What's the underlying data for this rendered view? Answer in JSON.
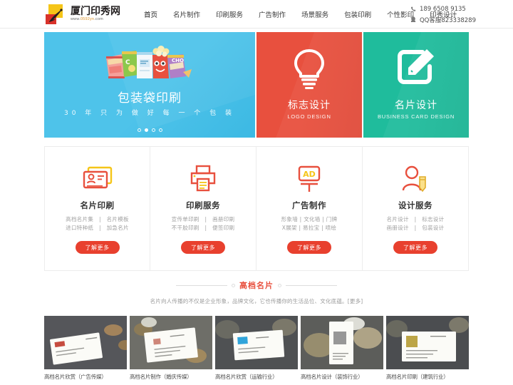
{
  "header": {
    "logo": {
      "cn": "厦门印秀网",
      "url_pre": "www.",
      "url_hl": "0592yn",
      "url_post": ".com"
    },
    "nav": [
      {
        "label": "首页",
        "active": true
      },
      {
        "label": "名片制作",
        "active": false
      },
      {
        "label": "印刷服务",
        "active": false
      },
      {
        "label": "广告制作",
        "active": false
      },
      {
        "label": "场景服务",
        "active": false
      },
      {
        "label": "包装印刷",
        "active": false
      },
      {
        "label": "个性影印",
        "active": false
      },
      {
        "label": "印秀设计",
        "active": false
      }
    ],
    "contact": {
      "phone_icon": "phone-icon",
      "phone": "189 6508 9135",
      "qq_icon": "qq-penguin-icon",
      "qq": "QQ客服823338289"
    }
  },
  "hero": {
    "main": {
      "title": "包装袋印刷",
      "subtitle": "30 年 只 为 做 好 每 一 个 包 装",
      "icon": "snack-bags-illustration",
      "bg_color": "#4ec3ea",
      "dots": 4,
      "active_dot": 2
    },
    "tiles": [
      {
        "cn": "标志设计",
        "en": "LOGO DESIGN",
        "icon": "lightbulb-icon",
        "color": "#e8503e"
      },
      {
        "cn": "名片设计",
        "en": "BUSINESS CARD DESIGN",
        "icon": "edit-square-pencil-icon",
        "color": "#1fbc9c"
      }
    ]
  },
  "cards": [
    {
      "icon": "id-card-icon",
      "title": "名片印刷",
      "line1": "高档名片集　|　名片模板",
      "line2": "进口特种纸　|　加急名片",
      "button": "了解更多"
    },
    {
      "icon": "printer-icon",
      "title": "印刷服务",
      "line1": "宣传单印刷　|　画册印刷",
      "line2": "不干胶印刷　|　便签印刷",
      "button": "了解更多"
    },
    {
      "icon": "ad-board-icon",
      "title": "广告制作",
      "line1": "形象墙 | 文化墙 | 门牌",
      "line2": "X展架 | 易拉宝 | 喷绘",
      "button": "了解更多"
    },
    {
      "icon": "designer-person-pencil-icon",
      "title": "设计服务",
      "line1": "名片设计　|　标志设计",
      "line2": "画册设计　|　包装设计",
      "button": "了解更多"
    }
  ],
  "section": {
    "title": "高档名片",
    "desc": "名片向人传播的不仅是企业形象，品牌文化，它也传播你的生活品位、文化底蕴。[更多]"
  },
  "gallery": [
    {
      "caption": "高档名片欣赏（广告传媒）",
      "accent": "#c0392b"
    },
    {
      "caption": "高档名片制作（婚庆传媒）",
      "accent": "#c9796a"
    },
    {
      "caption": "高档名片欣赏（运输行业）",
      "accent": "#1a9ad6"
    },
    {
      "caption": "高档名片设计（装饰行业）",
      "accent": "#8c8c8c"
    },
    {
      "caption": "高档名片印刷（建筑行业）",
      "accent": "#b59b33"
    }
  ],
  "colors": {
    "accent_red": "#e8503e",
    "button_red": "#e8402e",
    "hero_blue": "#4ec3ea",
    "teal": "#1fbc9c",
    "icon_yellow": "#f5c518"
  }
}
